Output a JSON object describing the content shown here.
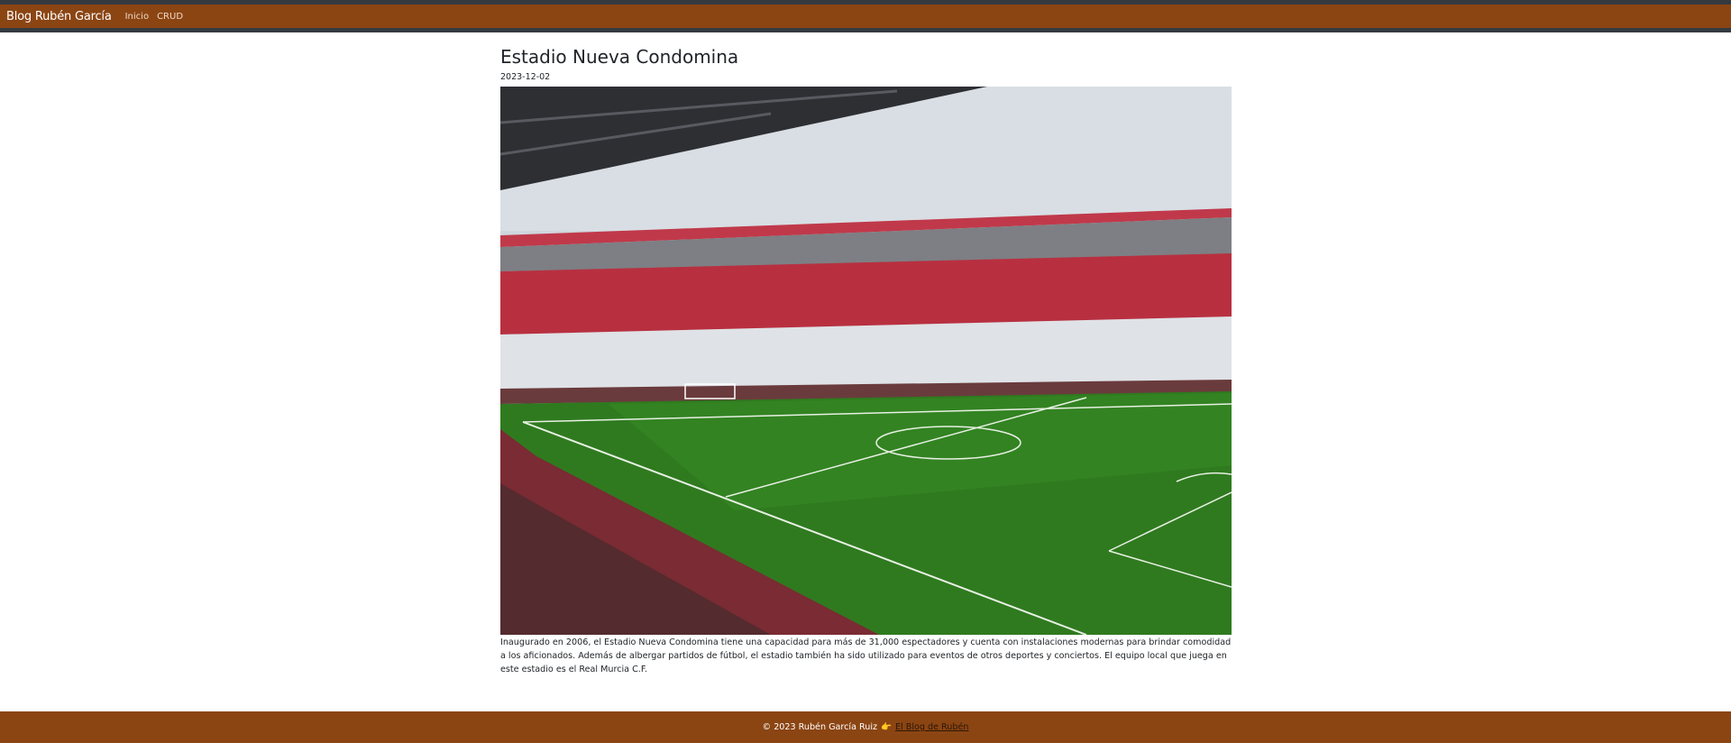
{
  "navbar": {
    "brand": "Blog Rubén García",
    "links": [
      "Inicio",
      "CRUD"
    ]
  },
  "post": {
    "title": "Estadio Nueva Condomina",
    "date": "2023-12-02",
    "image_alt": "stadium-photo",
    "body": "Inaugurado en 2006, el Estadio Nueva Condomina tiene una capacidad para más de 31,000 espectadores y cuenta con instalaciones modernas para brindar comodidad a los aficionados. Además de albergar partidos de fútbol, el estadio también ha sido utilizado para eventos de otros deportes y conciertos. El equipo local que juega en este estadio es el Real Murcia C.F."
  },
  "footer": {
    "copyright": "© 2023 Rubén García Ruiz",
    "pointer_icon": "pointing-hand-icon",
    "link": "El Blog de Rubén"
  },
  "colors": {
    "brand_brown": "#8b4513",
    "dark_border": "#343a40",
    "pitch_green": "#2f7a1f",
    "seat_red": "#c8323c"
  }
}
